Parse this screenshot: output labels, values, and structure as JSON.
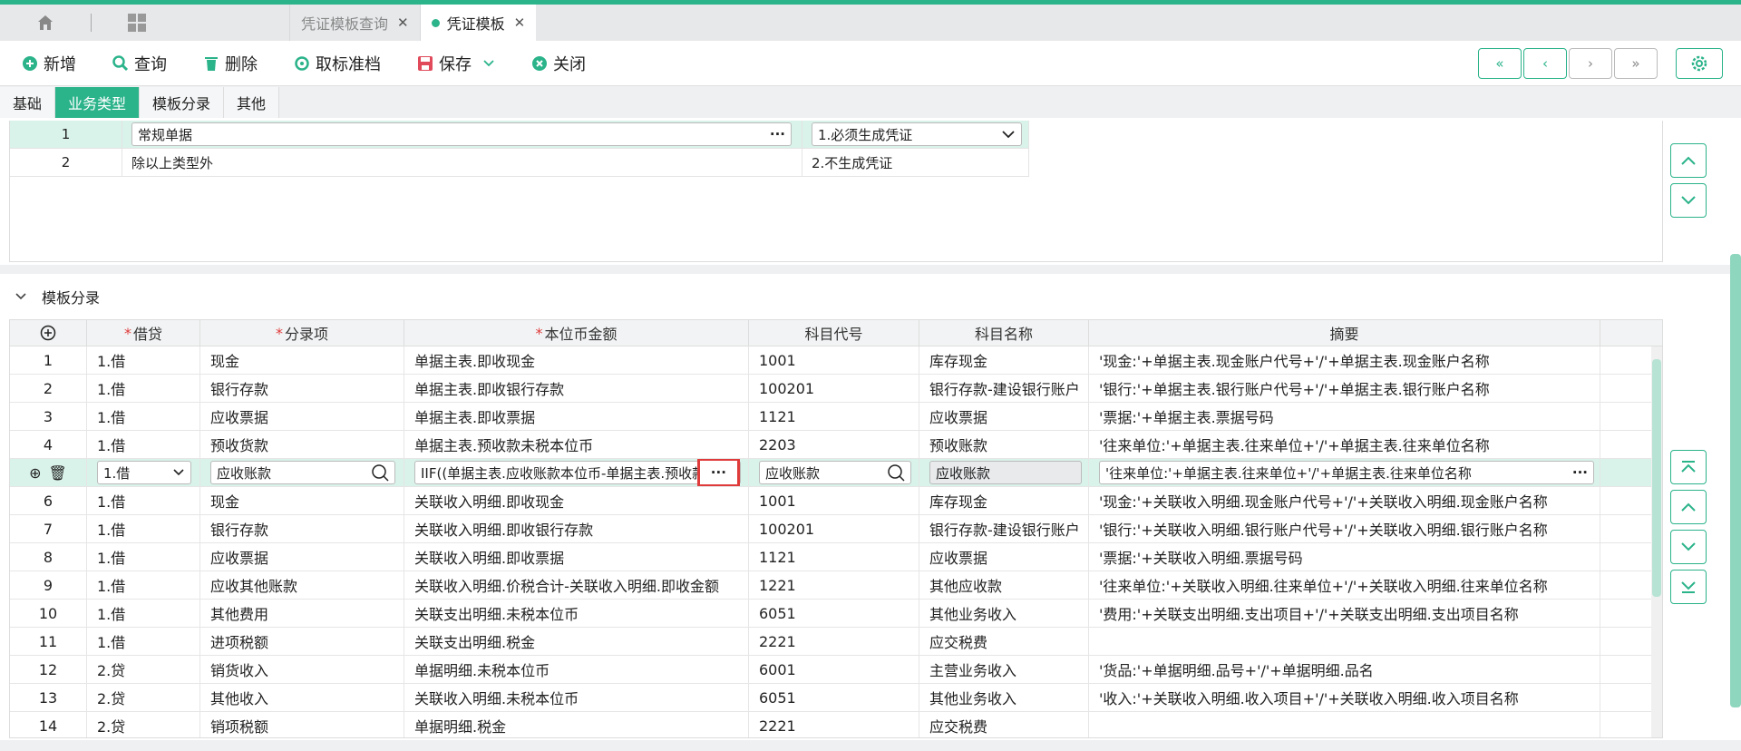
{
  "tabs": {
    "items": [
      {
        "label": "凭证模板查询",
        "active": false
      },
      {
        "label": "凭证模板",
        "active": true
      }
    ]
  },
  "toolbar": {
    "add": "新增",
    "query": "查询",
    "delete": "删除",
    "unmark": "取标准档",
    "save": "保存",
    "close": "关闭"
  },
  "subtabs": [
    "基础",
    "业务类型",
    "模板分录",
    "其他"
  ],
  "biz_types": [
    {
      "no": "1",
      "name": "常规单据",
      "rule": "1.必须生成凭证"
    },
    {
      "no": "2",
      "name": "除以上类型外",
      "rule": "2.不生成凭证"
    }
  ],
  "entries_section": {
    "title": "模板分录"
  },
  "entries_headers": [
    "借贷",
    "分录项",
    "本位币金额",
    "科目代号",
    "科目名称",
    "摘要"
  ],
  "entries": [
    {
      "no": "1",
      "dc": "1.借",
      "item": "现金",
      "amount": "单据主表.即收现金",
      "code": "1001",
      "name": "库存现金",
      "summary": "'现金:'+单据主表.现金账户代号+'/'+单据主表.现金账户名称"
    },
    {
      "no": "2",
      "dc": "1.借",
      "item": "银行存款",
      "amount": "单据主表.即收银行存款",
      "code": "100201",
      "name": "银行存款-建设银行账户",
      "summary": "'银行:'+单据主表.银行账户代号+'/'+单据主表.银行账户名称"
    },
    {
      "no": "3",
      "dc": "1.借",
      "item": "应收票据",
      "amount": "单据主表.即收票据",
      "code": "1121",
      "name": "应收票据",
      "summary": "'票据:'+单据主表.票据号码"
    },
    {
      "no": "4",
      "dc": "1.借",
      "item": "预收货款",
      "amount": "单据主表.预收款未税本位币",
      "code": "2203",
      "name": "预收账款",
      "summary": "'往来单位:'+单据主表.往来单位+'/'+单据主表.往来单位名称"
    },
    {
      "no": "",
      "dc": "1.借",
      "item": "应收账款",
      "amount": "IIF((单据主表.应收账款本位币-单据主表.预收款",
      "code": "应收账款",
      "name": "应收账款",
      "summary": "'往来单位:'+单据主表.往来单位+'/'+单据主表.往来单位名称"
    },
    {
      "no": "6",
      "dc": "1.借",
      "item": "现金",
      "amount": "关联收入明细.即收现金",
      "code": "1001",
      "name": "库存现金",
      "summary": "'现金:'+关联收入明细.现金账户代号+'/'+关联收入明细.现金账户名称"
    },
    {
      "no": "7",
      "dc": "1.借",
      "item": "银行存款",
      "amount": "关联收入明细.即收银行存款",
      "code": "100201",
      "name": "银行存款-建设银行账户",
      "summary": "'银行:'+关联收入明细.银行账户代号+'/'+关联收入明细.银行账户名称"
    },
    {
      "no": "8",
      "dc": "1.借",
      "item": "应收票据",
      "amount": "关联收入明细.即收票据",
      "code": "1121",
      "name": "应收票据",
      "summary": "'票据:'+关联收入明细.票据号码"
    },
    {
      "no": "9",
      "dc": "1.借",
      "item": "应收其他账款",
      "amount": "关联收入明细.价税合计-关联收入明细.即收金额",
      "code": "1221",
      "name": "其他应收款",
      "summary": "'往来单位:'+关联收入明细.往来单位+'/'+关联收入明细.往来单位名称"
    },
    {
      "no": "10",
      "dc": "1.借",
      "item": "其他费用",
      "amount": "关联支出明细.未税本位币",
      "code": "6051",
      "name": "其他业务收入",
      "summary": "'费用:'+关联支出明细.支出项目+'/'+关联支出明细.支出项目名称"
    },
    {
      "no": "11",
      "dc": "1.借",
      "item": "进项税额",
      "amount": "关联支出明细.税金",
      "code": "2221",
      "name": "应交税费",
      "summary": ""
    },
    {
      "no": "12",
      "dc": "2.贷",
      "item": "销货收入",
      "amount": "单据明细.未税本位币",
      "code": "6001",
      "name": "主营业务收入",
      "summary": "'货品:'+单据明细.品号+'/'+单据明细.品名"
    },
    {
      "no": "13",
      "dc": "2.贷",
      "item": "其他收入",
      "amount": "关联收入明细.未税本位币",
      "code": "6051",
      "name": "其他业务收入",
      "summary": "'收入:'+关联收入明细.收入项目+'/'+关联收入明细.收入项目名称"
    },
    {
      "no": "14",
      "dc": "2.贷",
      "item": "销项税额",
      "amount": "单据明细.税金",
      "code": "2221",
      "name": "应交税费",
      "summary": ""
    }
  ],
  "colors": {
    "accent": "#2bb38a",
    "required": "#e03b3b",
    "selected_row": "#d9f2ea"
  }
}
